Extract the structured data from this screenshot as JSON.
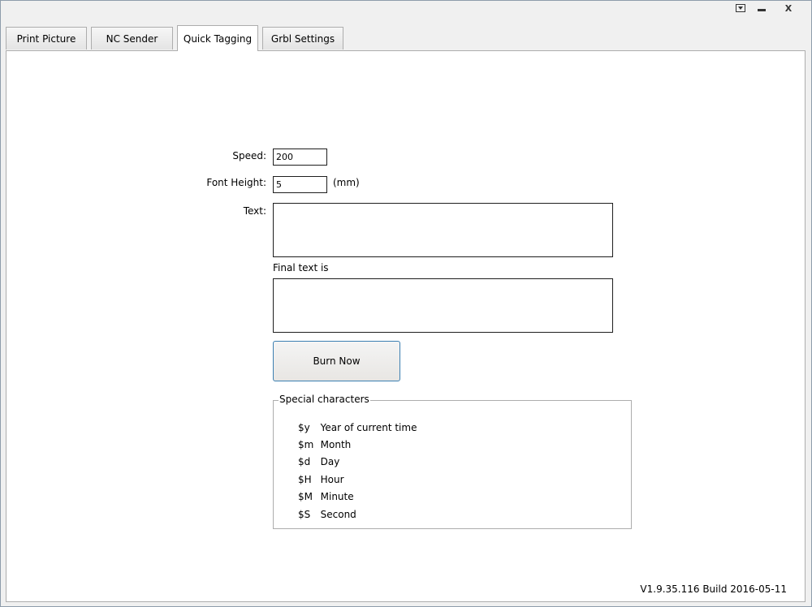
{
  "tabs": [
    "Print Picture",
    "NC Sender",
    "Quick Tagging",
    "Grbl Settings"
  ],
  "active_tab": "Quick Tagging",
  "form": {
    "speed_label": "Speed:",
    "speed_value": "200",
    "font_height_label": "Font Height:",
    "font_height_value": "5",
    "font_height_unit": "(mm)",
    "text_label": "Text:",
    "text_value": "",
    "final_text_label": "Final text is",
    "final_text_value": ""
  },
  "burn_button": "Burn Now",
  "special_characters": {
    "title": "Special characters",
    "items": [
      {
        "code": "$y",
        "desc": "Year of current time"
      },
      {
        "code": "$m",
        "desc": "Month"
      },
      {
        "code": "$d",
        "desc": "Day"
      },
      {
        "code": "$H",
        "desc": "Hour"
      },
      {
        "code": "$M",
        "desc": "Minute"
      },
      {
        "code": "$S",
        "desc": "Second"
      }
    ]
  },
  "version": "V1.9.35.116 Build 2016-05-11",
  "window_controls": {
    "minimize": "—",
    "close": "X"
  }
}
